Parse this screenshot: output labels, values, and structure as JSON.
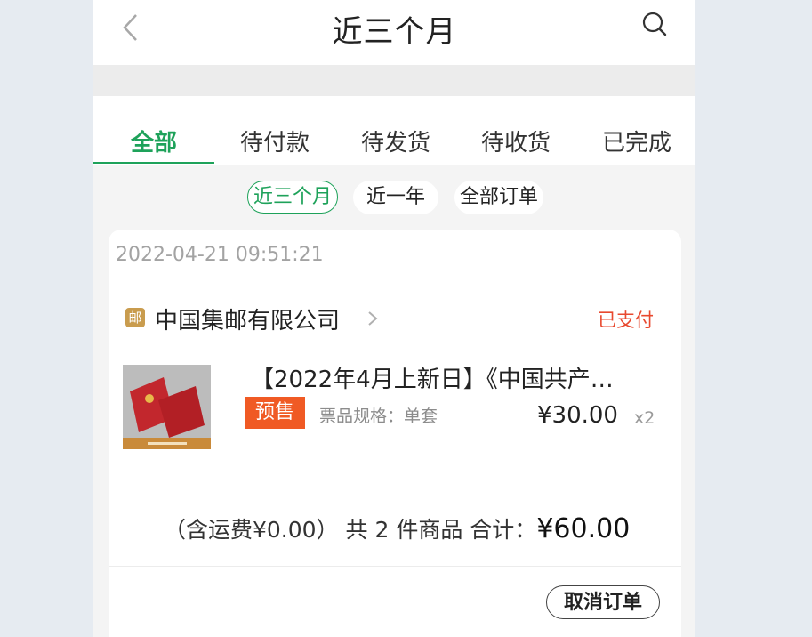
{
  "header": {
    "title": "近三个月"
  },
  "tabs": [
    {
      "label": "全部"
    },
    {
      "label": "待付款"
    },
    {
      "label": "待发货"
    },
    {
      "label": "待收货"
    },
    {
      "label": "已完成"
    }
  ],
  "filters": [
    {
      "label": "近三个月"
    },
    {
      "label": "近一年"
    },
    {
      "label": "全部订单"
    }
  ],
  "order": {
    "date": "2022-04-21 09:51:21",
    "shop_icon_text": "邮",
    "shop_name": "中国集邮有限公司",
    "status": "已支付",
    "product": {
      "title": "【2022年4月上新日】《中国共产…",
      "badge": "预售",
      "spec": "票品规格：单套",
      "price": "¥30.00",
      "qty": "x2"
    },
    "summary": {
      "shipping": "（含运费¥0.00）",
      "count": "共 2 件商品",
      "total_label": "合计：",
      "total": "¥60.00"
    },
    "cancel_label": "取消订单"
  },
  "colors": {
    "accent": "#1ea25a",
    "status": "#e8492f",
    "badge": "#f05a24"
  },
  "icons": [
    "back-chevron-icon",
    "search-icon",
    "shop-stamp-icon",
    "chevron-right-icon"
  ]
}
